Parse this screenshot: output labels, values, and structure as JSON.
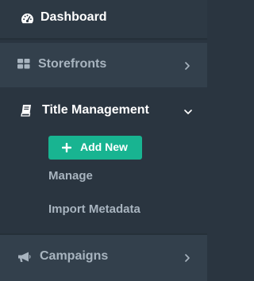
{
  "sidebar": {
    "items": [
      {
        "label": "Dashboard",
        "icon": "dashboard-gauge-icon",
        "expanded": false,
        "active": true
      },
      {
        "label": "Storefronts",
        "icon": "grid-icon",
        "chevron": "chevron-right-icon"
      },
      {
        "label": "Title Management",
        "icon": "book-icon",
        "chevron": "chevron-down-icon",
        "expanded": true
      },
      {
        "label": "Campaigns",
        "icon": "megaphone-icon",
        "chevron": "chevron-right-icon"
      }
    ],
    "submenu": {
      "add_new": {
        "label": "Add New",
        "icon": "plus-icon"
      },
      "links": [
        {
          "label": "Manage"
        },
        {
          "label": "Import Metadata"
        }
      ]
    }
  },
  "colors": {
    "background": "#2a3540",
    "item_bg_alt": "#33404c",
    "text_active": "#ffffff",
    "text_muted": "#a8b4bf",
    "accent": "#18b491"
  }
}
